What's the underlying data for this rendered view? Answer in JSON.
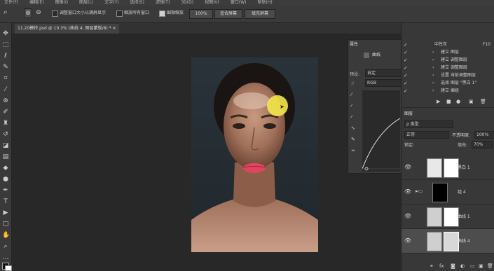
{
  "menubar": {
    "items": [
      "文件(F)",
      "编辑(E)",
      "图像(I)",
      "图层(L)",
      "文字(Y)",
      "选择(S)",
      "滤镜(T)",
      "3D(D)",
      "视图(V)",
      "窗口(W)",
      "帮助(H)"
    ]
  },
  "options": {
    "resize_windows_label": "调整窗口大小以满屏显示",
    "zoom_all_label": "缩放所有窗口",
    "scrubby_zoom_label": "细微缩放",
    "zoom_value": "100%",
    "fit_screen_label": "适合屏幕",
    "fill_screen_label": "填充屏幕"
  },
  "document": {
    "tab_title": "11.20模特.psd @ 10.3% (曲线 4, 图层蒙版/8) *"
  },
  "properties": {
    "panel_label": "属性",
    "adjust_label": "曲线",
    "preset_label": "预设:",
    "preset_value": "自定",
    "channel_value": "RGB"
  },
  "history": {
    "snapshot_label": "中性灰",
    "snapshot_key": "F10",
    "items": [
      "建立 图层",
      "建立 调整图层",
      "建立 调整图层",
      "设置 当前调整图层",
      "选择 图层 \"黑白 1\"",
      "建立 编组"
    ]
  },
  "layers": {
    "panel_label": "图层",
    "filter_label": "ρ 类型",
    "blend_mode": "正常",
    "opacity_label": "不透明度:",
    "opacity_value": "100%",
    "lock_label": "锁定:",
    "fill_label": "填充:",
    "fill_value": "70%",
    "rows": [
      {
        "name": "黑白 1"
      },
      {
        "name": "组 4"
      },
      {
        "name": "曲线 1"
      },
      {
        "name": "曲线 4"
      }
    ]
  },
  "colors": {
    "highlight": "#f3e64a",
    "lips": "#e0455f"
  }
}
